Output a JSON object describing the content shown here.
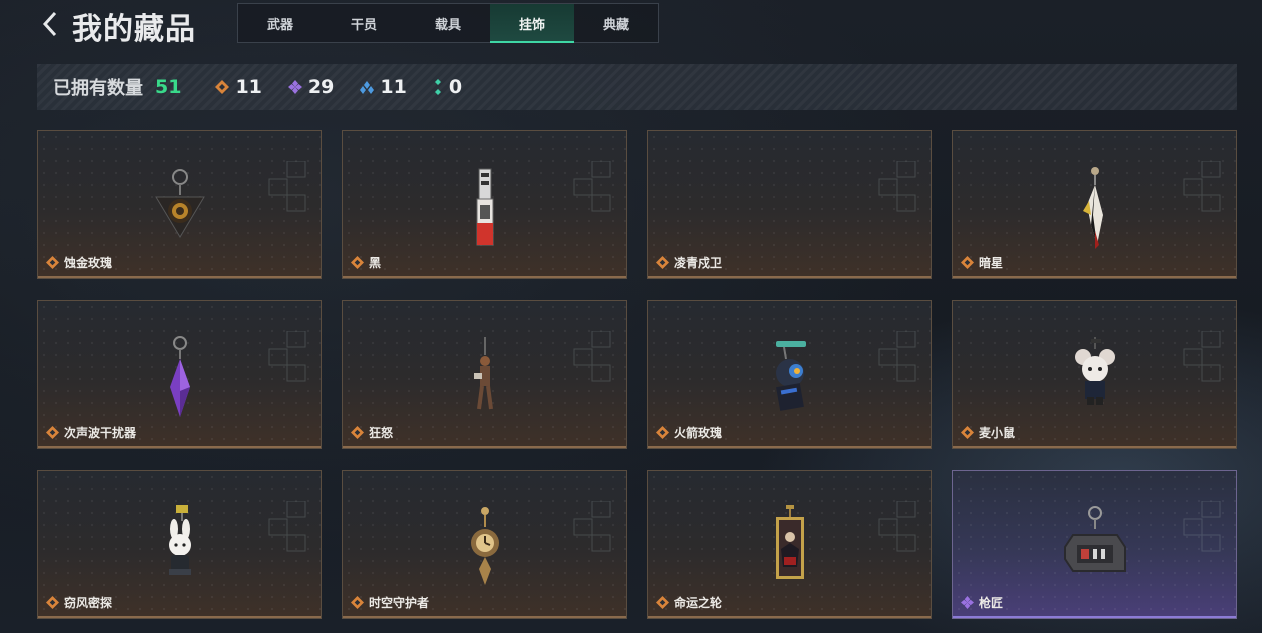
{
  "header": {
    "back_label": "<",
    "title": "我的藏品",
    "tabs": [
      {
        "label": "武器"
      },
      {
        "label": "干员"
      },
      {
        "label": "载具"
      },
      {
        "label": "挂饰"
      },
      {
        "label": "典藏"
      }
    ],
    "active_tab": "挂饰"
  },
  "stats": {
    "owned_label": "已拥有数量",
    "owned_total": "51",
    "rarities": [
      {
        "icon": "orange-diamond-icon",
        "color": "#d9843a",
        "count": "11"
      },
      {
        "icon": "purple-diamond-icon",
        "color": "#9a72e0",
        "count": "29"
      },
      {
        "icon": "blue-diamond-icon",
        "color": "#4d9ae0",
        "count": "11"
      },
      {
        "icon": "green-dots-icon",
        "color": "#3fd0a8",
        "count": "0"
      }
    ]
  },
  "items": [
    {
      "name": "蚀金玫瑰",
      "rarity": "orange",
      "art": "rose-charm"
    },
    {
      "name": "黑",
      "rarity": "orange",
      "art": "card-charm"
    },
    {
      "name": "凌青戍卫",
      "rarity": "orange",
      "art": "empty"
    },
    {
      "name": "暗星",
      "rarity": "orange",
      "art": "feather-charm"
    },
    {
      "name": "次声波干扰器",
      "rarity": "orange",
      "art": "crystal-charm"
    },
    {
      "name": "狂怒",
      "rarity": "orange",
      "art": "figure-charm"
    },
    {
      "name": "火箭玫瑰",
      "rarity": "orange",
      "art": "robot-charm"
    },
    {
      "name": "麦小鼠",
      "rarity": "orange",
      "art": "mouse-charm"
    },
    {
      "name": "窃风密探",
      "rarity": "orange",
      "art": "rabbit-charm"
    },
    {
      "name": "时空守护者",
      "rarity": "orange",
      "art": "clock-charm"
    },
    {
      "name": "命运之轮",
      "rarity": "orange",
      "art": "frame-charm"
    },
    {
      "name": "枪匠",
      "rarity": "purple",
      "art": "box-charm"
    }
  ],
  "colors": {
    "accent_green": "#39d98a",
    "tab_active": "#1f4a41",
    "orange_rarity": "#d9843a",
    "purple_rarity": "#9a72e0"
  }
}
